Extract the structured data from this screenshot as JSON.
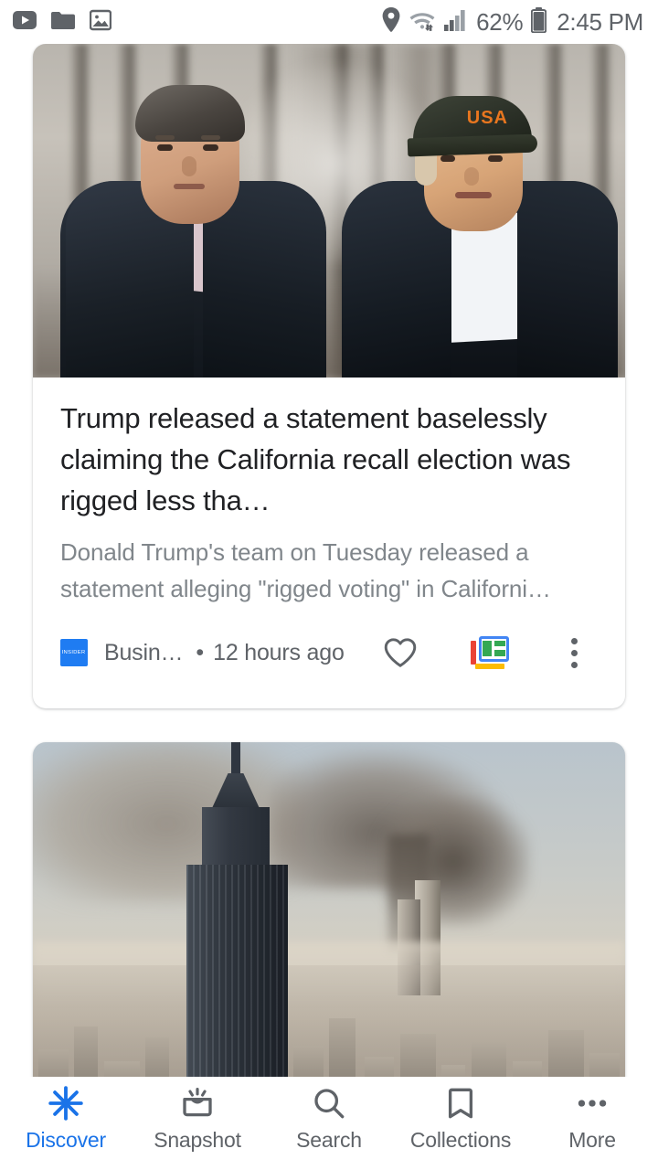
{
  "status_bar": {
    "notification_icons": [
      "youtube-play-icon",
      "folder-icon",
      "image-icon"
    ],
    "system_icons": [
      "location-pin-icon",
      "wifi-icon",
      "signal-bars-icon",
      "battery-icon"
    ],
    "battery_percent": "62%",
    "clock": "2:45 PM"
  },
  "feed": {
    "cards": [
      {
        "photo_alt": "Two men in dark jackets standing in a burned forest, the man on the right wearing a black USA cap",
        "headline": "Trump released a statement baselessly claiming the California recall election was rigged less tha…",
        "snippet": "Donald Trump's team on Tuesday released a statement alleging \"rigged voting\" in Californi…",
        "publisher_logo_text": "INSIDER",
        "publisher_logo_color": "#1f7cf2",
        "publisher": "Busin…",
        "separator": "•",
        "timestamp": "12 hours ago",
        "actions": [
          "heart-icon",
          "google-news-icon",
          "overflow-menu-icon"
        ]
      },
      {
        "photo_alt": "New York City skyline with the Empire State Building in the foreground and smoke rising from the World Trade Center towers"
      }
    ]
  },
  "bottom_nav": {
    "items": [
      {
        "label": "Discover",
        "icon": "discover-asterisk-icon",
        "active": true
      },
      {
        "label": "Snapshot",
        "icon": "snapshot-tray-icon",
        "active": false
      },
      {
        "label": "Search",
        "icon": "search-icon",
        "active": false
      },
      {
        "label": "Collections",
        "icon": "bookmark-icon",
        "active": false
      },
      {
        "label": "More",
        "icon": "more-dots-icon",
        "active": false
      }
    ],
    "active_color": "#1a73e8",
    "inactive_color": "#5f6368"
  }
}
